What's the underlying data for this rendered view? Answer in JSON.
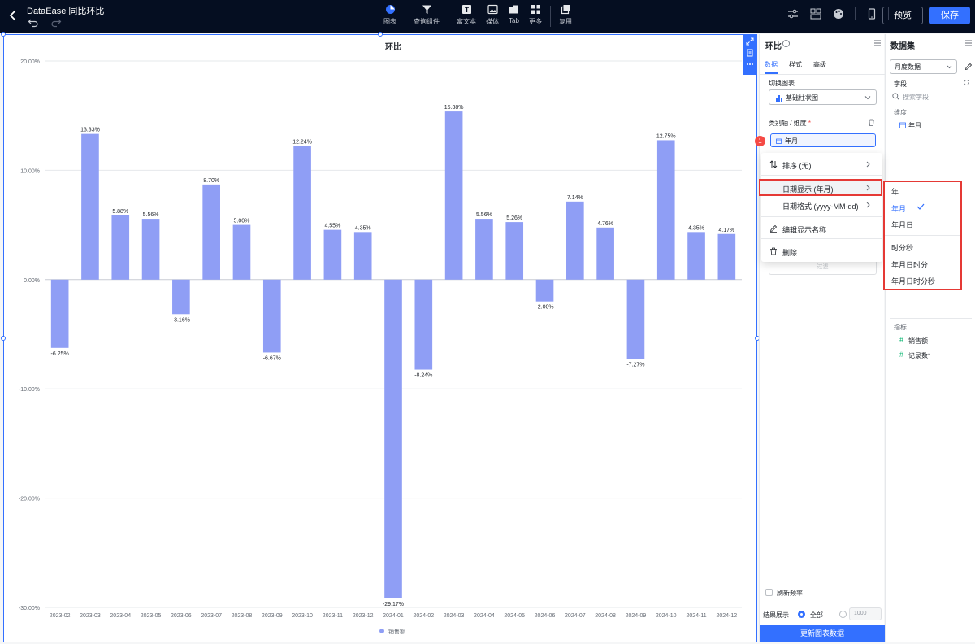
{
  "app": {
    "title": "DataEase 同比环比",
    "preview_label": "预览",
    "save_label": "保存"
  },
  "toolbar": [
    {
      "name": "chart",
      "label": "图表"
    },
    {
      "name": "query",
      "label": "查询组件"
    },
    {
      "name": "richtext",
      "label": "富文本"
    },
    {
      "name": "media",
      "label": "媒体"
    },
    {
      "name": "tab",
      "label": "Tab"
    },
    {
      "name": "more",
      "label": "更多"
    },
    {
      "name": "reuse",
      "label": "复用"
    }
  ],
  "chart_data": {
    "type": "bar",
    "title": "环比",
    "categories": [
      "2023-02",
      "2023-03",
      "2023-04",
      "2023-05",
      "2023-06",
      "2023-07",
      "2023-08",
      "2023-09",
      "2023-10",
      "2023-11",
      "2023-12",
      "2024-01",
      "2024-02",
      "2024-03",
      "2024-04",
      "2024-05",
      "2024-06",
      "2024-07",
      "2024-08",
      "2024-09",
      "2024-10",
      "2024-11",
      "2024-12"
    ],
    "values": [
      -6.25,
      13.33,
      5.88,
      5.56,
      -3.16,
      8.7,
      5.0,
      -6.67,
      12.24,
      4.55,
      4.35,
      -29.17,
      -8.24,
      15.38,
      5.56,
      5.26,
      -2.0,
      7.14,
      4.76,
      -7.27,
      12.75,
      4.35,
      4.17
    ],
    "labels": [
      "-6.25%",
      "13.33%",
      "5.88%",
      "5.56%",
      "-3.16%",
      "8.70%",
      "5.00%",
      "-6.67%",
      "12.24%",
      "4.55%",
      "4.35%",
      "-29.17%",
      "-8.24%",
      "15.38%",
      "5.56%",
      "5.26%",
      "-2.00%",
      "7.14%",
      "4.76%",
      "-7.27%",
      "12.75%",
      "4.35%",
      "4.17%"
    ],
    "yticks": [
      "20.00%",
      "10.00%",
      "0.00%",
      "-10.00%",
      "-20.00%",
      "-30.00%"
    ],
    "ylim": [
      -30,
      20
    ],
    "series": [
      {
        "name": "销售额"
      }
    ],
    "legend": "bottom-center",
    "color": "#8f9ef5",
    "grid": true
  },
  "config_panel": {
    "title": "环比",
    "tabs": [
      "数据",
      "样式",
      "高级"
    ],
    "switch_chart_label": "切换图表",
    "chart_type": "基础柱状图",
    "axis_label": "类别轴 / 维度",
    "required_mark": "*",
    "dimension_pill": "年月",
    "badge": "1",
    "filter_label": "过滤",
    "refresh_label": "刷新频率",
    "result_label": "结果展示",
    "result_all": "全部",
    "result_count_placeholder": "1000",
    "update_button": "更新图表数据"
  },
  "context_menu": {
    "items": [
      {
        "label": "排序 (无)"
      },
      {
        "label": "日期显示 (年月)"
      },
      {
        "label": "日期格式 (yyyy-MM-dd)"
      },
      {
        "label": "编辑显示名称"
      },
      {
        "label": "删除"
      }
    ]
  },
  "date_submenu": {
    "items": [
      "年",
      "年月",
      "年月日",
      "时分秒",
      "年月日时分",
      "年月日时分秒"
    ],
    "selected": "年月"
  },
  "dataset_panel": {
    "title": "数据集",
    "dataset": "月度数据",
    "fields_label": "字段",
    "search_placeholder": "搜索字段",
    "dimension_label": "维度",
    "dimensions": [
      "年月"
    ],
    "measure_label": "指标",
    "measures": [
      "销售额",
      "记录数*"
    ]
  }
}
